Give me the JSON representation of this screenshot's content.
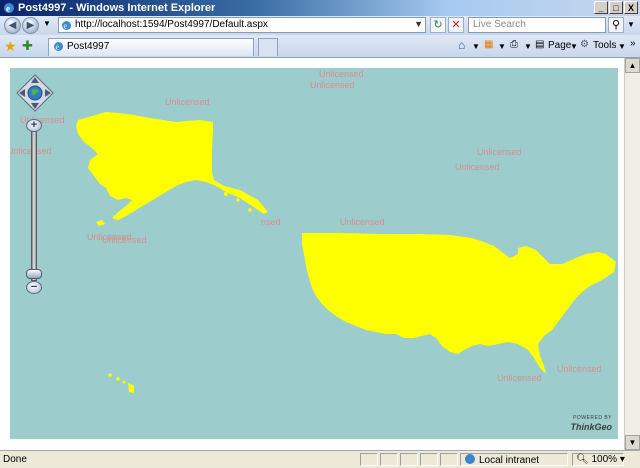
{
  "window": {
    "title": "Post4997 - Windows Internet Explorer",
    "controls": {
      "minimize": "_",
      "maximize": "□",
      "close": "X"
    }
  },
  "address_bar": {
    "url": "http://localhost:1594/Post4997/Default.aspx",
    "search_placeholder": "Live Search"
  },
  "tabs": [
    {
      "label": "Post4997"
    }
  ],
  "command_bar": {
    "page_label": "Page",
    "tools_label": "Tools"
  },
  "map": {
    "land_color": "#ffff00",
    "water_color": "#9ccdcc",
    "watermarks": [
      "Unlicensed",
      "Unlicensed",
      "Unlicensed",
      "Unlicensed",
      "Unlicensed",
      "Unlicensed",
      "Unlicensed",
      "Unlicensed",
      "Unlicensed",
      "Unlicensed",
      "Unlicensed",
      "Unlicensed",
      "Unlicensed",
      "Unlicensed"
    ],
    "watermark_partial": [
      "nsed",
      "icensed"
    ],
    "powered_by": "POWERED BY",
    "brand": "ThinkGeo"
  },
  "status_bar": {
    "status_text": "Done",
    "zone": "Local intranet",
    "zoom": "100%"
  }
}
